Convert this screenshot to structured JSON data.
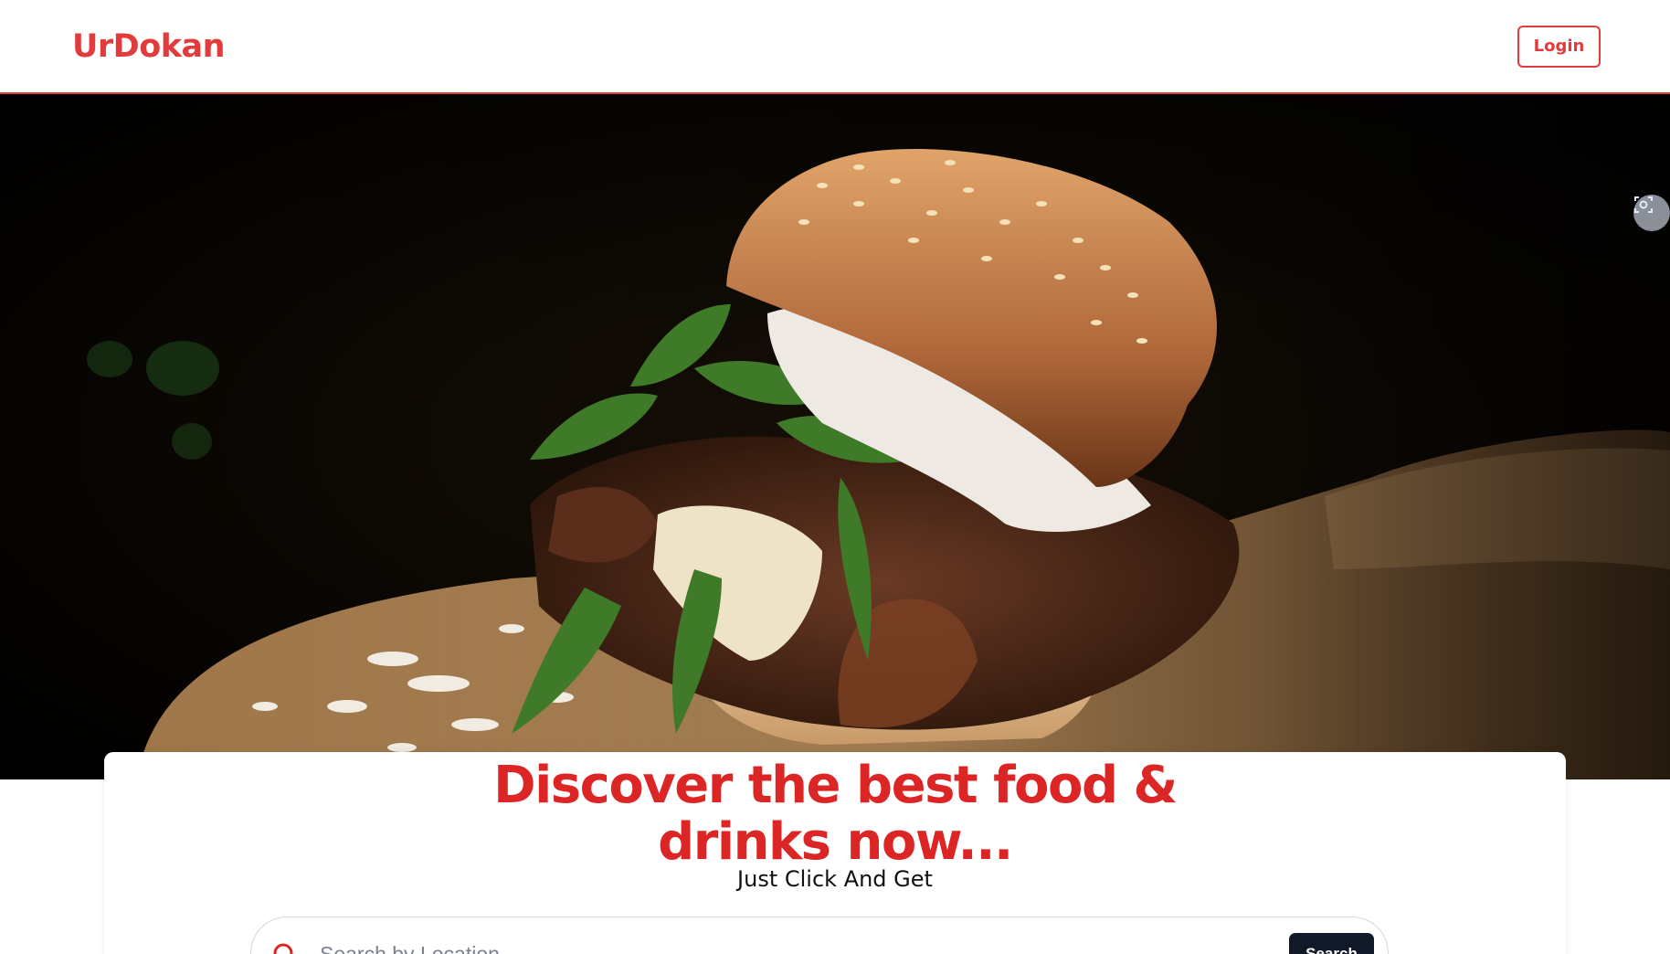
{
  "header": {
    "logo": "UrDokan",
    "login_label": "Login"
  },
  "hero": {
    "image_subject": "burger-photo"
  },
  "main": {
    "headline_line1": "Discover the best food &",
    "headline_line2": "drinks now...",
    "subline": "Just Click And Get",
    "search": {
      "placeholder": "Search by Location",
      "button_label": "Search"
    }
  },
  "colors": {
    "brand": "#e23b3b",
    "headline": "#dc2626",
    "search_button": "#111827"
  },
  "icons": {
    "search": "search-icon",
    "lens": "visual-search-icon"
  }
}
